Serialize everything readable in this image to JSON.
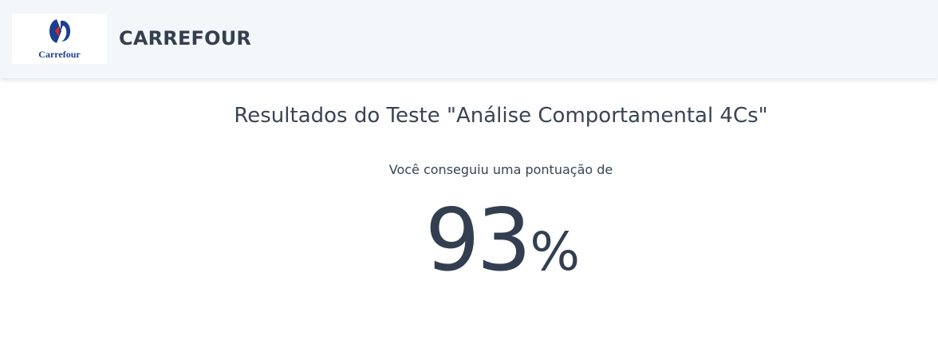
{
  "header": {
    "logo_text": "Carrefour",
    "brand_name": "CARREFOUR",
    "logo_colors": {
      "blue": "#1d3f8f",
      "red": "#e1251b"
    }
  },
  "main": {
    "title": "Resultados do Teste \"Análise Comportamental 4Cs\"",
    "subtitle": "Você conseguiu uma pontuação de",
    "score_value": "93",
    "score_unit": "%"
  }
}
